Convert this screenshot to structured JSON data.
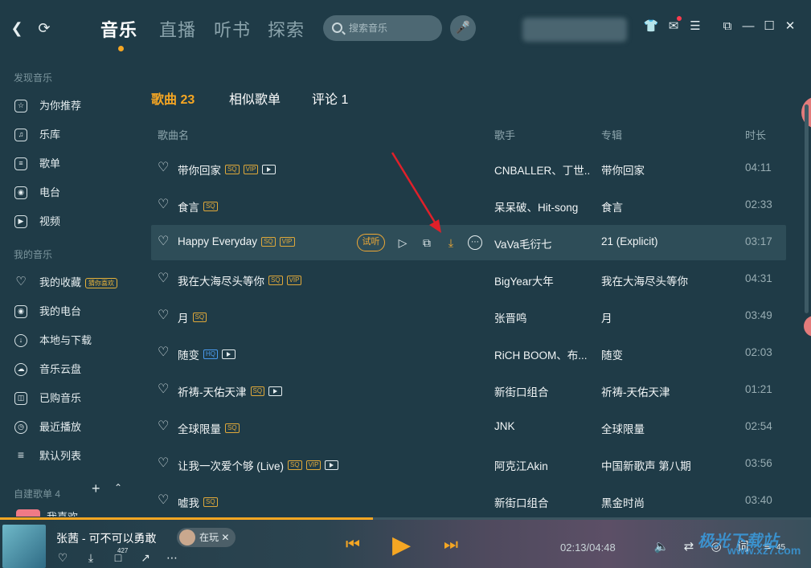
{
  "header": {
    "tabs": [
      "音乐",
      "直播",
      "听书",
      "探索"
    ],
    "search_placeholder": "搜索音乐"
  },
  "sidebar": {
    "discover_title": "发现音乐",
    "discover": [
      "为你推荐",
      "乐库",
      "歌单",
      "电台",
      "视频"
    ],
    "my_title": "我的音乐",
    "my": [
      "我的收藏",
      "我的电台",
      "本地与下载",
      "音乐云盘",
      "已购音乐",
      "最近播放",
      "默认列表"
    ],
    "guess_badge": "猜你喜欢",
    "playlist_title": "自建歌单 4",
    "mylike": "我喜欢"
  },
  "subtabs": [
    "歌曲 23",
    "相似歌单",
    "评论 1"
  ],
  "columns": {
    "name": "歌曲名",
    "artist": "歌手",
    "album": "专辑",
    "duration": "时长"
  },
  "row_actions": {
    "try_label": "试听"
  },
  "songs": [
    {
      "title": "带你回家",
      "artist": "CNBALLER、丁世...",
      "album": "带你回家",
      "duration": "04:11"
    },
    {
      "title": "食言",
      "artist": "呆呆破、Hit-song",
      "album": "食言",
      "duration": "02:33"
    },
    {
      "title": "Happy Everyday",
      "artist": "VaVa毛衍七",
      "album": "21 (Explicit)",
      "duration": "03:17"
    },
    {
      "title": "我在大海尽头等你",
      "artist": "BigYear大年",
      "album": "我在大海尽头等你",
      "duration": "04:31"
    },
    {
      "title": "月",
      "artist": "张晋鸣",
      "album": "月",
      "duration": "03:49"
    },
    {
      "title": "随变",
      "artist": "RiCH BOOM、布...",
      "album": "随变",
      "duration": "02:03"
    },
    {
      "title": "祈祷-天佑天津",
      "artist": "新街口组合",
      "album": "祈祷-天佑天津",
      "duration": "01:21"
    },
    {
      "title": "全球限量",
      "artist": "JNK",
      "album": "全球限量",
      "duration": "02:54"
    },
    {
      "title": "让我一次爱个够 (Live)",
      "artist": "阿克江Akin",
      "album": "中国新歌声 第八期",
      "duration": "03:56"
    },
    {
      "title": "嘘我",
      "artist": "新街口组合",
      "album": "黑金时尚",
      "duration": "03:40"
    }
  ],
  "tag_labels": {
    "sq": "SQ",
    "vip": "VIP",
    "hq": "HQ"
  },
  "player": {
    "song": "张茜 - 可不可以勇敢",
    "playing_label": "在玩",
    "comment_count": "427",
    "time": "02:13/04:48",
    "progress": 0.46,
    "lyric_btn": "词",
    "queue_count": "45"
  },
  "watermark": {
    "text": "极光下载站",
    "url": "www.xz7.com"
  },
  "colors": {
    "accent": "#f5a623",
    "bg": "#1f3b47",
    "highlight_row": "#2e4d58",
    "arrow": "#e0202a"
  }
}
